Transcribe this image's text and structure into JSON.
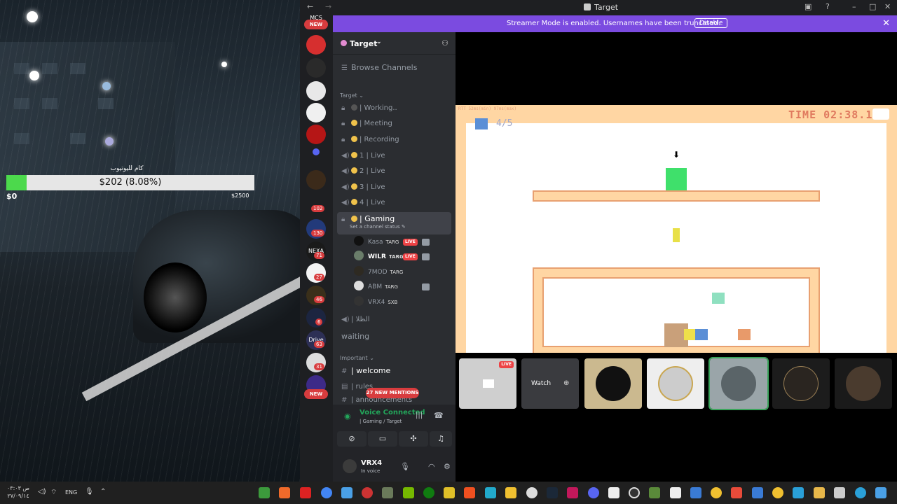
{
  "stream_overlay": {
    "goal_title": "كام لليوتيوب",
    "goal_text": "$202 (8.08%)",
    "goal_progress_percent": 8.08,
    "goal_min": "$0",
    "goal_max": "$2500"
  },
  "window": {
    "title": "Target",
    "back_icon": "←",
    "forward_icon": "→"
  },
  "banner": {
    "message": "Streamer Mode is enabled. Usernames have been truncated.",
    "disable_label": "Disable",
    "close_icon": "✕"
  },
  "servers": {
    "top_label": "MCS",
    "new_label": "NEW",
    "badges": [
      "102",
      "130",
      "71",
      "27",
      "46",
      "6",
      "63",
      "31"
    ],
    "labels": [
      "NEXA",
      "Drive"
    ]
  },
  "guild": {
    "name": "Target",
    "browse": "Browse Channels",
    "category_target": "Target",
    "category_important": "Important",
    "channels": [
      {
        "name": "| Working..",
        "icon": "lock"
      },
      {
        "name": "| Meeting",
        "icon": "lock"
      },
      {
        "name": "| Recording",
        "icon": "lock"
      },
      {
        "name": "1 | Live",
        "icon": "speaker"
      },
      {
        "name": "2 | Live",
        "icon": "speaker"
      },
      {
        "name": "3 | Live",
        "icon": "speaker"
      },
      {
        "name": "4 | Live",
        "icon": "speaker"
      },
      {
        "name": "| Gaming",
        "icon": "lock"
      }
    ],
    "gaming_status": "Set a channel status",
    "members": [
      {
        "name": "Kasa",
        "tag": "TARG",
        "live": "LIVE"
      },
      {
        "name": "WILR",
        "tag": "TARG",
        "live": "LIVE"
      },
      {
        "name": "7MOD",
        "tag": "TARG",
        "live": ""
      },
      {
        "name": "ABM",
        "tag": "TARG",
        "live": ""
      },
      {
        "name": "VRX4",
        "tag": "SXB",
        "live": ""
      }
    ],
    "channel_nightly": "| الظلا",
    "channel_waiting": "waiting",
    "channel_welcome": "| welcome",
    "channel_rules": "| rules",
    "channel_announcements": "| announcements",
    "mentions": "27 NEW MENTIONS"
  },
  "voice": {
    "status": "Voice Connected",
    "location": "| Gaming / Target",
    "user_name": "VRX4",
    "user_status": "In voice"
  },
  "game": {
    "rtt": "RTT 52ms(min) 97ms(max)",
    "time": "TIME 02:38.1",
    "count": "4/5"
  },
  "thumbs": {
    "live_label": "LIVE",
    "watch_label": "Watch"
  },
  "taskbar": {
    "time": "ص ٠٣:٠٣",
    "date": "٢٧/٠٩/١٤",
    "lang": "ENG"
  },
  "colors": {
    "banner": "#7b4be0",
    "live": "#ed4245",
    "voice_green": "#23a55a",
    "goal_fill": "#4cd94c"
  }
}
